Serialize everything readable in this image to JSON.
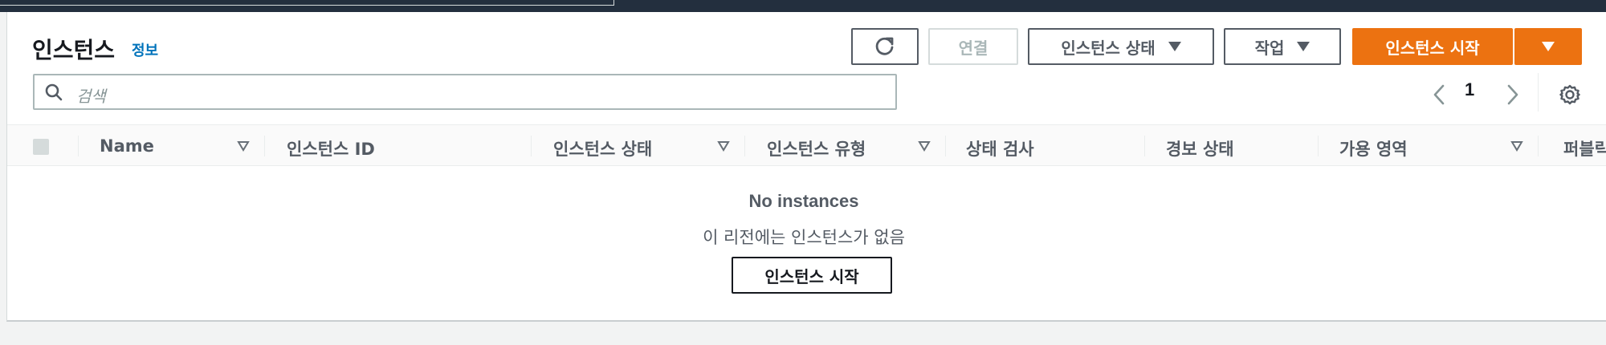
{
  "header": {
    "title": "인스턴스",
    "info_link": "정보",
    "refresh_icon": "refresh-icon",
    "connect_label": "연결",
    "instance_state_label": "인스턴스 상태",
    "actions_label": "작업",
    "launch_label": "인스턴스 시작"
  },
  "search": {
    "placeholder": "검색",
    "icon": "search-icon"
  },
  "pagination": {
    "current_page": "1",
    "prev_icon": "chevron-left-icon",
    "next_icon": "chevron-right-icon",
    "settings_icon": "gear-icon"
  },
  "table": {
    "columns": [
      "Name",
      "인스턴스 ID",
      "인스턴스 상태",
      "인스턴스 유형",
      "상태 검사",
      "경보 상태",
      "가용 영역",
      "퍼블릭"
    ]
  },
  "empty": {
    "title": "No instances",
    "message": "이 리전에는 인스턴스가 없음",
    "button_label": "인스턴스 시작"
  },
  "colors": {
    "primary": "#ec7211",
    "link": "#0073bb",
    "topbar": "#232f3e"
  }
}
